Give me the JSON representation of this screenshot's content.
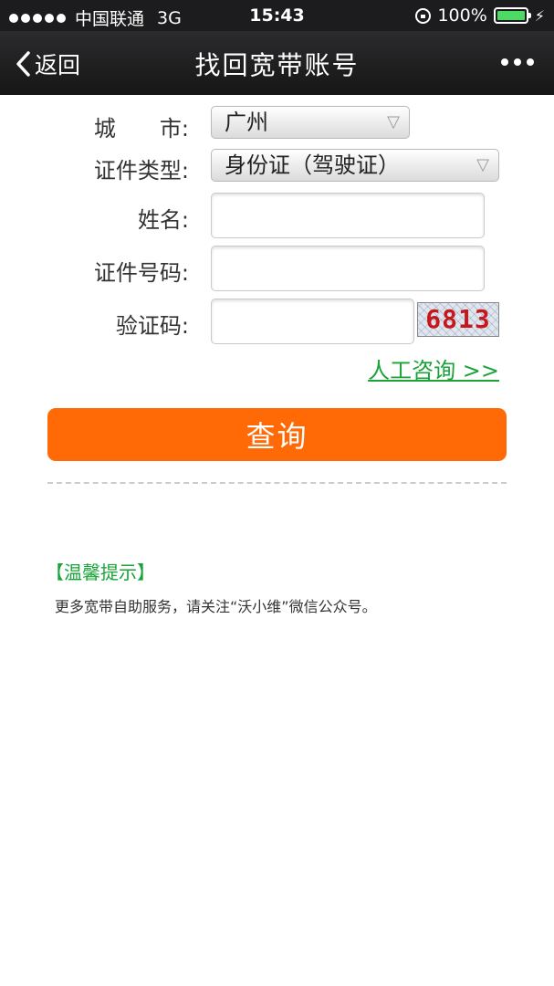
{
  "status_bar": {
    "carrier": "中国联通",
    "network": "3G",
    "time": "15:43",
    "battery": "100%",
    "battery_level": 1.0,
    "battery_color": "#4cd964"
  },
  "nav": {
    "back_label": "返回",
    "title": "找回宽带账号"
  },
  "form": {
    "city": {
      "label": "城　　市:",
      "value": "广州"
    },
    "id_type": {
      "label": "证件类型:",
      "value": "身份证（驾驶证）"
    },
    "name": {
      "label": "姓名:",
      "value": ""
    },
    "id_number": {
      "label": "证件号码:",
      "value": ""
    },
    "captcha": {
      "label": "验证码:",
      "value": "",
      "image_text": "6813"
    },
    "help_link": "人工咨询 >>",
    "submit_label": "查询"
  },
  "tips": {
    "title": "【温馨提示】",
    "text": "更多宽带自助服务，请关注“沃小维”微信公众号。"
  },
  "colors": {
    "accent": "#ff6a06",
    "link": "#19a339",
    "header": "#1c1c1e"
  }
}
